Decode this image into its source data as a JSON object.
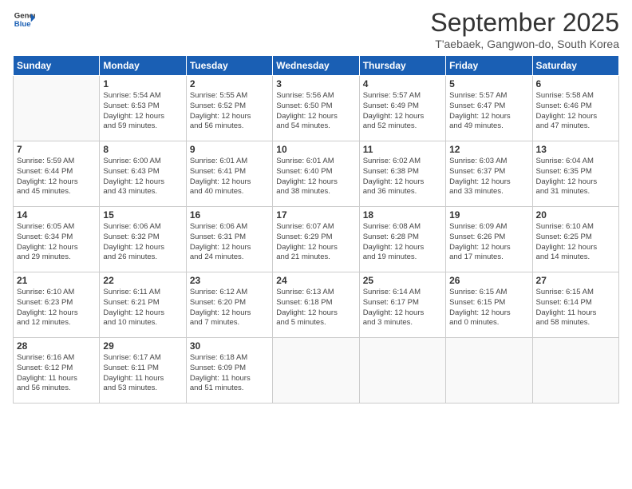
{
  "logo": {
    "line1": "General",
    "line2": "Blue"
  },
  "title": "September 2025",
  "location": "T'aebaek, Gangwon-do, South Korea",
  "days_of_week": [
    "Sunday",
    "Monday",
    "Tuesday",
    "Wednesday",
    "Thursday",
    "Friday",
    "Saturday"
  ],
  "weeks": [
    [
      {
        "day": "",
        "info": ""
      },
      {
        "day": "1",
        "info": "Sunrise: 5:54 AM\nSunset: 6:53 PM\nDaylight: 12 hours\nand 59 minutes."
      },
      {
        "day": "2",
        "info": "Sunrise: 5:55 AM\nSunset: 6:52 PM\nDaylight: 12 hours\nand 56 minutes."
      },
      {
        "day": "3",
        "info": "Sunrise: 5:56 AM\nSunset: 6:50 PM\nDaylight: 12 hours\nand 54 minutes."
      },
      {
        "day": "4",
        "info": "Sunrise: 5:57 AM\nSunset: 6:49 PM\nDaylight: 12 hours\nand 52 minutes."
      },
      {
        "day": "5",
        "info": "Sunrise: 5:57 AM\nSunset: 6:47 PM\nDaylight: 12 hours\nand 49 minutes."
      },
      {
        "day": "6",
        "info": "Sunrise: 5:58 AM\nSunset: 6:46 PM\nDaylight: 12 hours\nand 47 minutes."
      }
    ],
    [
      {
        "day": "7",
        "info": "Sunrise: 5:59 AM\nSunset: 6:44 PM\nDaylight: 12 hours\nand 45 minutes."
      },
      {
        "day": "8",
        "info": "Sunrise: 6:00 AM\nSunset: 6:43 PM\nDaylight: 12 hours\nand 43 minutes."
      },
      {
        "day": "9",
        "info": "Sunrise: 6:01 AM\nSunset: 6:41 PM\nDaylight: 12 hours\nand 40 minutes."
      },
      {
        "day": "10",
        "info": "Sunrise: 6:01 AM\nSunset: 6:40 PM\nDaylight: 12 hours\nand 38 minutes."
      },
      {
        "day": "11",
        "info": "Sunrise: 6:02 AM\nSunset: 6:38 PM\nDaylight: 12 hours\nand 36 minutes."
      },
      {
        "day": "12",
        "info": "Sunrise: 6:03 AM\nSunset: 6:37 PM\nDaylight: 12 hours\nand 33 minutes."
      },
      {
        "day": "13",
        "info": "Sunrise: 6:04 AM\nSunset: 6:35 PM\nDaylight: 12 hours\nand 31 minutes."
      }
    ],
    [
      {
        "day": "14",
        "info": "Sunrise: 6:05 AM\nSunset: 6:34 PM\nDaylight: 12 hours\nand 29 minutes."
      },
      {
        "day": "15",
        "info": "Sunrise: 6:06 AM\nSunset: 6:32 PM\nDaylight: 12 hours\nand 26 minutes."
      },
      {
        "day": "16",
        "info": "Sunrise: 6:06 AM\nSunset: 6:31 PM\nDaylight: 12 hours\nand 24 minutes."
      },
      {
        "day": "17",
        "info": "Sunrise: 6:07 AM\nSunset: 6:29 PM\nDaylight: 12 hours\nand 21 minutes."
      },
      {
        "day": "18",
        "info": "Sunrise: 6:08 AM\nSunset: 6:28 PM\nDaylight: 12 hours\nand 19 minutes."
      },
      {
        "day": "19",
        "info": "Sunrise: 6:09 AM\nSunset: 6:26 PM\nDaylight: 12 hours\nand 17 minutes."
      },
      {
        "day": "20",
        "info": "Sunrise: 6:10 AM\nSunset: 6:25 PM\nDaylight: 12 hours\nand 14 minutes."
      }
    ],
    [
      {
        "day": "21",
        "info": "Sunrise: 6:10 AM\nSunset: 6:23 PM\nDaylight: 12 hours\nand 12 minutes."
      },
      {
        "day": "22",
        "info": "Sunrise: 6:11 AM\nSunset: 6:21 PM\nDaylight: 12 hours\nand 10 minutes."
      },
      {
        "day": "23",
        "info": "Sunrise: 6:12 AM\nSunset: 6:20 PM\nDaylight: 12 hours\nand 7 minutes."
      },
      {
        "day": "24",
        "info": "Sunrise: 6:13 AM\nSunset: 6:18 PM\nDaylight: 12 hours\nand 5 minutes."
      },
      {
        "day": "25",
        "info": "Sunrise: 6:14 AM\nSunset: 6:17 PM\nDaylight: 12 hours\nand 3 minutes."
      },
      {
        "day": "26",
        "info": "Sunrise: 6:15 AM\nSunset: 6:15 PM\nDaylight: 12 hours\nand 0 minutes."
      },
      {
        "day": "27",
        "info": "Sunrise: 6:15 AM\nSunset: 6:14 PM\nDaylight: 11 hours\nand 58 minutes."
      }
    ],
    [
      {
        "day": "28",
        "info": "Sunrise: 6:16 AM\nSunset: 6:12 PM\nDaylight: 11 hours\nand 56 minutes."
      },
      {
        "day": "29",
        "info": "Sunrise: 6:17 AM\nSunset: 6:11 PM\nDaylight: 11 hours\nand 53 minutes."
      },
      {
        "day": "30",
        "info": "Sunrise: 6:18 AM\nSunset: 6:09 PM\nDaylight: 11 hours\nand 51 minutes."
      },
      {
        "day": "",
        "info": ""
      },
      {
        "day": "",
        "info": ""
      },
      {
        "day": "",
        "info": ""
      },
      {
        "day": "",
        "info": ""
      }
    ]
  ]
}
